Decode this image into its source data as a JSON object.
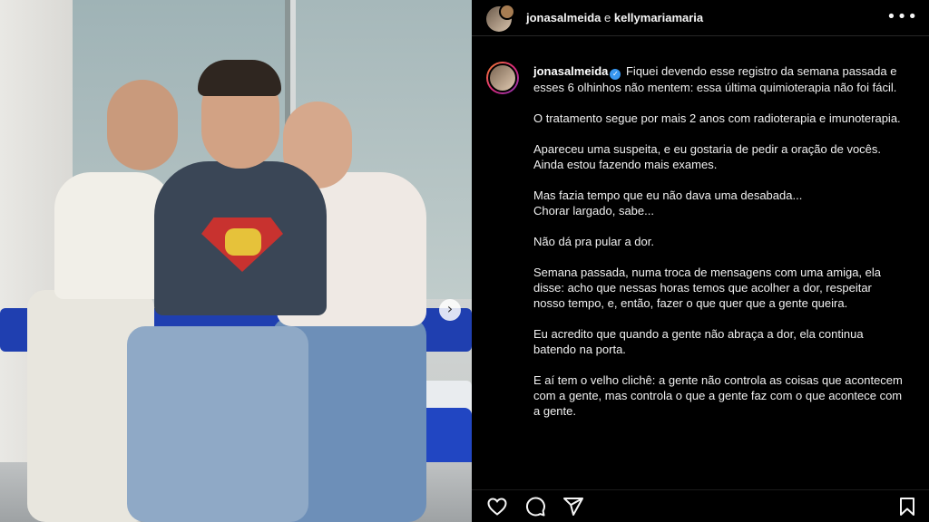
{
  "header": {
    "user1": "jonasalmeida",
    "conjunction": "e",
    "user2": "kellymariamaria",
    "more_icon": "more-options-icon"
  },
  "caption": {
    "username": "jonasalmeida",
    "verified_icon": "verified-badge-icon",
    "body": " Fiquei devendo esse registro da semana passada e esses 6 olhinhos não mentem: essa última quimioterapia não foi fácil.\n\nO tratamento segue por mais 2 anos com radioterapia e imunoterapia.\n\nApareceu uma suspeita, e eu gostaria de pedir a oração de vocês. Ainda estou fazendo mais exames.\n\nMas fazia tempo que eu não dava uma desabada...\nChorar largado, sabe...\n\nNão dá pra pular a dor.\n\nSemana passada, numa troca de mensagens com uma amiga, ela disse: acho que nessas horas temos que acolher a dor, respeitar nosso tempo, e, então, fazer o que quer que a gente queira.\n\nEu acredito que quando a gente não abraça a dor, ela continua batendo na porta.\n\nE aí tem o velho clichê: a gente não controla as coisas que acontecem com a gente, mas controla o que a gente faz com o que acontece com a gente."
  },
  "photo": {
    "next_glyph": "›"
  },
  "actions": {
    "icons": [
      "heart-icon",
      "comment-icon",
      "share-icon",
      "bookmark-icon"
    ]
  },
  "colors": {
    "background": "#000000",
    "text": "#f5f5f5",
    "verified": "#3897f0"
  }
}
